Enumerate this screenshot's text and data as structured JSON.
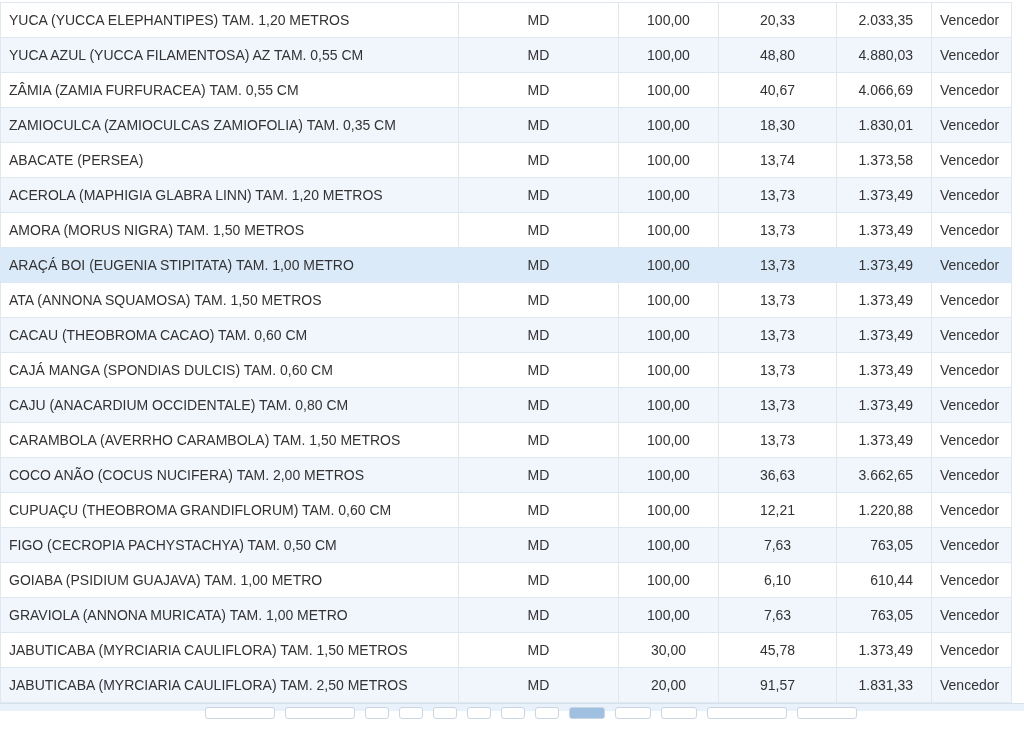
{
  "table": {
    "rows": [
      {
        "cells": [
          "YUCA (YUCCA ELEPHANTIPES) TAM. 1,20 METROS",
          "MD",
          "100,00",
          "20,33",
          "2.033,35",
          "Vencedor"
        ],
        "selected": false
      },
      {
        "cells": [
          "YUCA AZUL (YUCCA FILAMENTOSA) AZ TAM. 0,55 CM",
          "MD",
          "100,00",
          "48,80",
          "4.880,03",
          "Vencedor"
        ],
        "selected": false
      },
      {
        "cells": [
          "ZÂMIA (ZAMIA FURFURACEA) TAM. 0,55 CM",
          "MD",
          "100,00",
          "40,67",
          "4.066,69",
          "Vencedor"
        ],
        "selected": false
      },
      {
        "cells": [
          "ZAMIOCULCA (ZAMIOCULCAS ZAMIOFOLIA) TAM. 0,35 CM",
          "MD",
          "100,00",
          "18,30",
          "1.830,01",
          "Vencedor"
        ],
        "selected": false
      },
      {
        "cells": [
          "ABACATE (PERSEA)",
          "MD",
          "100,00",
          "13,74",
          "1.373,58",
          "Vencedor"
        ],
        "selected": false
      },
      {
        "cells": [
          "ACEROLA (MAPHIGIA GLABRA LINN) TAM. 1,20 METROS",
          "MD",
          "100,00",
          "13,73",
          "1.373,49",
          "Vencedor"
        ],
        "selected": false
      },
      {
        "cells": [
          "AMORA (MORUS NIGRA) TAM. 1,50 METROS",
          "MD",
          "100,00",
          "13,73",
          "1.373,49",
          "Vencedor"
        ],
        "selected": false
      },
      {
        "cells": [
          "ARAÇÁ BOI (EUGENIA STIPITATA) TAM. 1,00 METRO",
          "MD",
          "100,00",
          "13,73",
          "1.373,49",
          "Vencedor"
        ],
        "selected": true
      },
      {
        "cells": [
          "ATA (ANNONA SQUAMOSA) TAM. 1,50 METROS",
          "MD",
          "100,00",
          "13,73",
          "1.373,49",
          "Vencedor"
        ],
        "selected": false
      },
      {
        "cells": [
          "CACAU (THEOBROMA CACAO) TAM. 0,60 CM",
          "MD",
          "100,00",
          "13,73",
          "1.373,49",
          "Vencedor"
        ],
        "selected": false
      },
      {
        "cells": [
          "CAJÁ MANGA (SPONDIAS DULCIS) TAM. 0,60 CM",
          "MD",
          "100,00",
          "13,73",
          "1.373,49",
          "Vencedor"
        ],
        "selected": false
      },
      {
        "cells": [
          "CAJU (ANACARDIUM OCCIDENTALE) TAM. 0,80 CM",
          "MD",
          "100,00",
          "13,73",
          "1.373,49",
          "Vencedor"
        ],
        "selected": false
      },
      {
        "cells": [
          "CARAMBOLA (AVERRHO CARAMBOLA) TAM. 1,50 METROS",
          "MD",
          "100,00",
          "13,73",
          "1.373,49",
          "Vencedor"
        ],
        "selected": false
      },
      {
        "cells": [
          "COCO ANÃO (COCUS NUCIFERA) TAM. 2,00 METROS",
          "MD",
          "100,00",
          "36,63",
          "3.662,65",
          "Vencedor"
        ],
        "selected": false
      },
      {
        "cells": [
          "CUPUAÇU (THEOBROMA GRANDIFLORUM) TAM. 0,60 CM",
          "MD",
          "100,00",
          "12,21",
          "1.220,88",
          "Vencedor"
        ],
        "selected": false
      },
      {
        "cells": [
          "FIGO (CECROPIA PACHYSTACHYA) TAM. 0,50 CM",
          "MD",
          "100,00",
          "7,63",
          "763,05",
          "Vencedor"
        ],
        "selected": false
      },
      {
        "cells": [
          "GOIABA (PSIDIUM GUAJAVA) TAM. 1,00 METRO",
          "MD",
          "100,00",
          "6,10",
          "610,44",
          "Vencedor"
        ],
        "selected": false
      },
      {
        "cells": [
          "GRAVIOLA (ANNONA MURICATA) TAM. 1,00 METRO",
          "MD",
          "100,00",
          "7,63",
          "763,05",
          "Vencedor"
        ],
        "selected": false
      },
      {
        "cells": [
          "JABUTICABA (MYRCIARIA CAULIFLORA) TAM. 1,50 METROS",
          "MD",
          "30,00",
          "45,78",
          "1.373,49",
          "Vencedor"
        ],
        "selected": false
      },
      {
        "cells": [
          "JABUTICABA (MYRCIARIA CAULIFLORA) TAM. 2,50 METROS",
          "MD",
          "20,00",
          "91,57",
          "1.831,33",
          "Vencedor"
        ],
        "selected": false
      }
    ]
  }
}
